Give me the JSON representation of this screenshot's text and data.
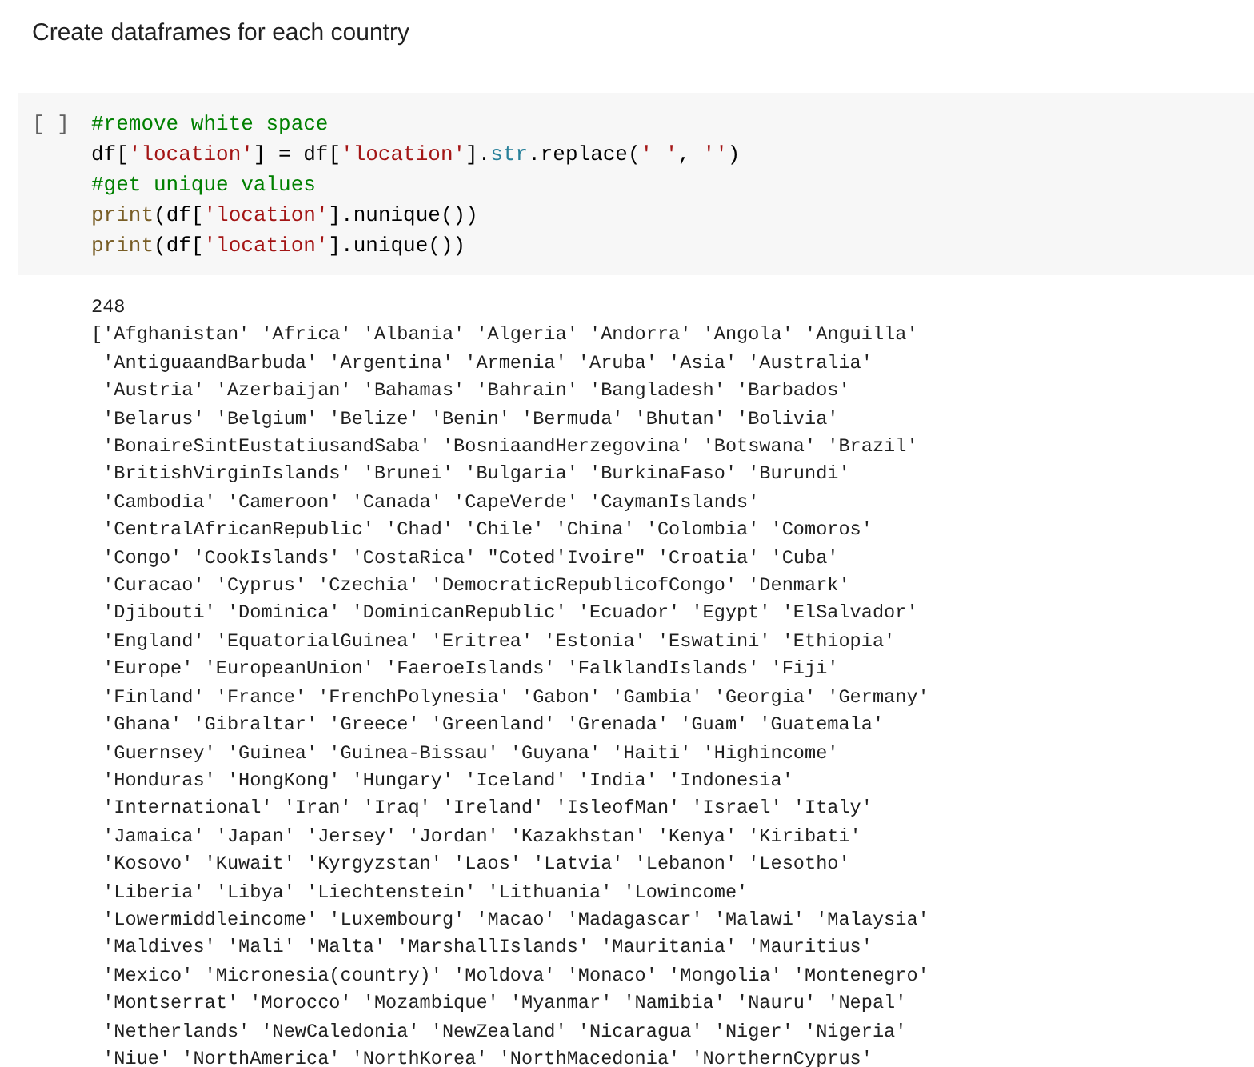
{
  "text_cell": {
    "heading": "Create dataframes for each country"
  },
  "code_cell": {
    "run_marker": "[ ]",
    "lines": [
      [
        {
          "kind": "comment",
          "text": "#remove white space"
        }
      ],
      [
        {
          "kind": "plain",
          "text": "df["
        },
        {
          "kind": "string",
          "text": "'location'"
        },
        {
          "kind": "plain",
          "text": "] = df["
        },
        {
          "kind": "string",
          "text": "'location'"
        },
        {
          "kind": "plain",
          "text": "]."
        },
        {
          "kind": "builtin",
          "text": "str"
        },
        {
          "kind": "plain",
          "text": ".replace("
        },
        {
          "kind": "string",
          "text": "' '"
        },
        {
          "kind": "plain",
          "text": ", "
        },
        {
          "kind": "string",
          "text": "''"
        },
        {
          "kind": "plain",
          "text": ")"
        }
      ],
      [
        {
          "kind": "comment",
          "text": "#get unique values"
        }
      ],
      [
        {
          "kind": "function",
          "text": "print"
        },
        {
          "kind": "plain",
          "text": "(df["
        },
        {
          "kind": "string",
          "text": "'location'"
        },
        {
          "kind": "plain",
          "text": "].nunique())"
        }
      ],
      [
        {
          "kind": "function",
          "text": "print"
        },
        {
          "kind": "plain",
          "text": "(df["
        },
        {
          "kind": "string",
          "text": "'location'"
        },
        {
          "kind": "plain",
          "text": "].unique())"
        }
      ]
    ]
  },
  "output": {
    "lines": [
      "248",
      "['Afghanistan' 'Africa' 'Albania' 'Algeria' 'Andorra' 'Angola' 'Anguilla'",
      "'AntiguaandBarbuda' 'Argentina' 'Armenia' 'Aruba' 'Asia' 'Australia'",
      "'Austria' 'Azerbaijan' 'Bahamas' 'Bahrain' 'Bangladesh' 'Barbados'",
      "'Belarus' 'Belgium' 'Belize' 'Benin' 'Bermuda' 'Bhutan' 'Bolivia'",
      "'BonaireSintEustatiusandSaba' 'BosniaandHerzegovina' 'Botswana' 'Brazil'",
      "'BritishVirginIslands' 'Brunei' 'Bulgaria' 'BurkinaFaso' 'Burundi'",
      "'Cambodia' 'Cameroon' 'Canada' 'CapeVerde' 'CaymanIslands'",
      "'CentralAfricanRepublic' 'Chad' 'Chile' 'China' 'Colombia' 'Comoros'",
      "'Congo' 'CookIslands' 'CostaRica' \"Coted'Ivoire\" 'Croatia' 'Cuba'",
      "'Curacao' 'Cyprus' 'Czechia' 'DemocraticRepublicofCongo' 'Denmark'",
      "'Djibouti' 'Dominica' 'DominicanRepublic' 'Ecuador' 'Egypt' 'ElSalvador'",
      "'England' 'EquatorialGuinea' 'Eritrea' 'Estonia' 'Eswatini' 'Ethiopia'",
      "'Europe' 'EuropeanUnion' 'FaeroeIslands' 'FalklandIslands' 'Fiji'",
      "'Finland' 'France' 'FrenchPolynesia' 'Gabon' 'Gambia' 'Georgia' 'Germany'",
      "'Ghana' 'Gibraltar' 'Greece' 'Greenland' 'Grenada' 'Guam' 'Guatemala'",
      "'Guernsey' 'Guinea' 'Guinea-Bissau' 'Guyana' 'Haiti' 'Highincome'",
      "'Honduras' 'HongKong' 'Hungary' 'Iceland' 'India' 'Indonesia'",
      "'International' 'Iran' 'Iraq' 'Ireland' 'IsleofMan' 'Israel' 'Italy'",
      "'Jamaica' 'Japan' 'Jersey' 'Jordan' 'Kazakhstan' 'Kenya' 'Kiribati'",
      "'Kosovo' 'Kuwait' 'Kyrgyzstan' 'Laos' 'Latvia' 'Lebanon' 'Lesotho'",
      "'Liberia' 'Libya' 'Liechtenstein' 'Lithuania' 'Lowincome'",
      "'Lowermiddleincome' 'Luxembourg' 'Macao' 'Madagascar' 'Malawi' 'Malaysia'",
      "'Maldives' 'Mali' 'Malta' 'MarshallIslands' 'Mauritania' 'Mauritius'",
      "'Mexico' 'Micronesia(country)' 'Moldova' 'Monaco' 'Mongolia' 'Montenegro'",
      "'Montserrat' 'Morocco' 'Mozambique' 'Myanmar' 'Namibia' 'Nauru' 'Nepal'",
      "'Netherlands' 'NewCaledonia' 'NewZealand' 'Nicaragua' 'Niger' 'Nigeria'",
      "'Niue' 'NorthAmerica' 'NorthKorea' 'NorthMacedonia' 'NorthernCyprus'"
    ]
  }
}
